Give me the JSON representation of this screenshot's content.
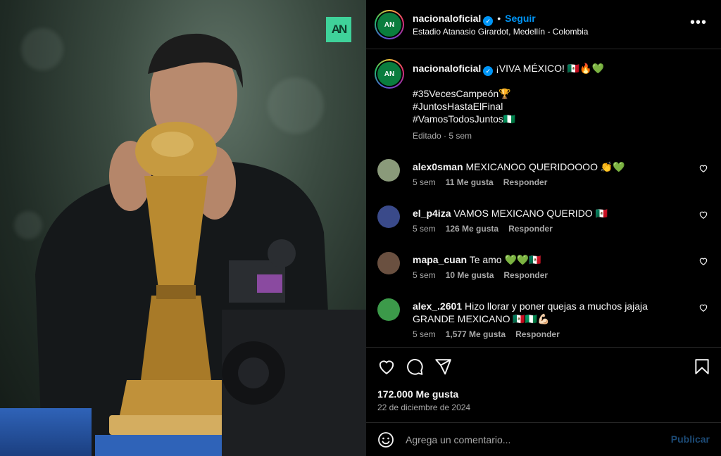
{
  "photo": {
    "logo_text": "AN",
    "alt_icon": "trophy-photo"
  },
  "post": {
    "username": "nacionaloficial",
    "follow_label": "Seguir",
    "separator": "•",
    "location": "Estadio Atanasio Girardot, Medellín - Colombia",
    "more_icon": "more-options-icon",
    "more_label": "•••",
    "verified_mark": "✓"
  },
  "caption": {
    "username": "nacionaloficial",
    "text": "¡VIVA MÉXICO! 🇲🇽🔥💚",
    "tags": [
      "#35VecesCampeón🏆",
      "#JuntosHastaElFinal",
      "#VamosTodosJuntos🇳🇬"
    ],
    "meta": "Editado · 5 sem"
  },
  "comments": [
    {
      "username": "alex0sman",
      "text": "MEXICANOO QUERIDOOOO 👏💚",
      "time": "5 sem",
      "likes": "11 Me gusta",
      "reply": "Responder",
      "avatar_color": "#8a9a7a"
    },
    {
      "username": "el_p4iza",
      "text": "VAMOS MEXICANO QUERIDO 🇲🇽",
      "time": "5 sem",
      "likes": "126 Me gusta",
      "reply": "Responder",
      "avatar_color": "#3a4a8a"
    },
    {
      "username": "mapa_cuan",
      "text": "Te amo 💚💚🇲🇽",
      "time": "5 sem",
      "likes": "10 Me gusta",
      "reply": "Responder",
      "avatar_color": "#6a5040"
    },
    {
      "username": "alex_.2601",
      "text": "Hizo llorar y poner quejas a muchos jajaja GRANDE MEXICANO 🇲🇽🇳🇬💪🏻",
      "time": "5 sem",
      "likes": "1,577 Me gusta",
      "reply": "Responder",
      "avatar_color": "#3c9a4a"
    }
  ],
  "actions": {
    "likes": "172.000 Me gusta",
    "date": "22 de diciembre de 2024"
  },
  "composer": {
    "placeholder": "Agrega un comentario...",
    "publish_label": "Publicar"
  },
  "colors": {
    "accent": "#0095f6",
    "background": "#000000",
    "muted": "#a8a8a8",
    "publish_disabled": "#1c4a75"
  }
}
